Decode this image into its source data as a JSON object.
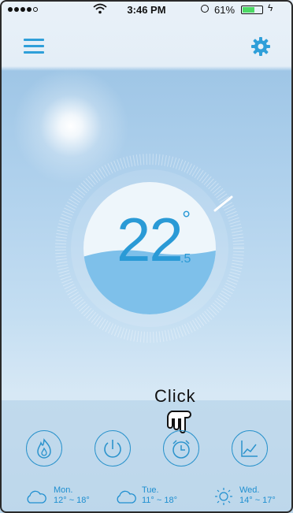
{
  "status_bar": {
    "time": "3:46 PM",
    "battery_pct": "61%",
    "battery_level": 0.61
  },
  "header": {
    "menu_icon": "hamburger-menu-icon",
    "settings_icon": "gear-icon"
  },
  "thermostat": {
    "temp_main": "22",
    "temp_degree": "°",
    "temp_decimal": ".5"
  },
  "hint": {
    "label": "Click"
  },
  "controls": [
    {
      "icon": "flame-icon"
    },
    {
      "icon": "power-icon"
    },
    {
      "icon": "alarm-clock-icon"
    },
    {
      "icon": "chart-line-icon"
    }
  ],
  "forecast": [
    {
      "day": "Mon.",
      "range": "12° ~ 18°",
      "icon": "cloud-icon"
    },
    {
      "day": "Tue.",
      "range": "11° ~ 18°",
      "icon": "cloud-icon"
    },
    {
      "day": "Wed.",
      "range": "14° ~ 17°",
      "icon": "sun-icon"
    }
  ],
  "colors": {
    "accent": "#2a9ad6",
    "water": "#7ec0ea"
  }
}
